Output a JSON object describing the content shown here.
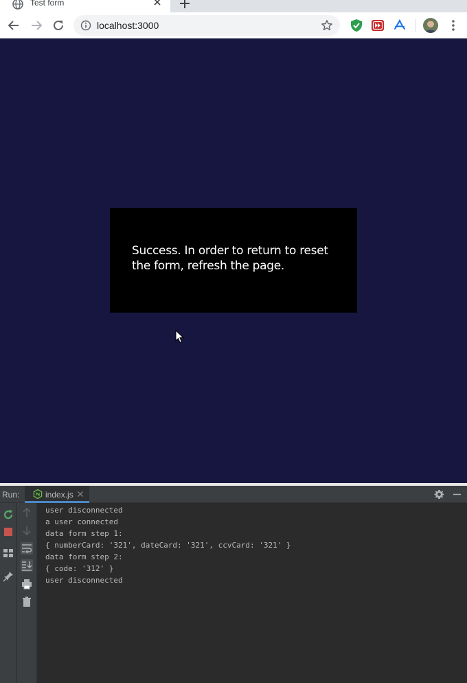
{
  "browser": {
    "tab_title": "Test form",
    "url": "localhost:3000"
  },
  "page": {
    "message": "Success. In order to return to reset the form, refresh the page."
  },
  "run_panel": {
    "label": "Run:",
    "tab_label": "index.js",
    "accent_color": "#4a88c7",
    "console_lines": [
      "user disconnected",
      "a user connected",
      "data form step 1:",
      "{ numberCard: '321', dateCard: '321', ccvCard: '321' }",
      "data form step 2:",
      "{ code: '312' }",
      "user disconnected"
    ]
  },
  "colors": {
    "page_background": "#161640",
    "message_box": "#000000",
    "console_background": "#2b2b2b",
    "console_text": "#bbbbbb"
  }
}
